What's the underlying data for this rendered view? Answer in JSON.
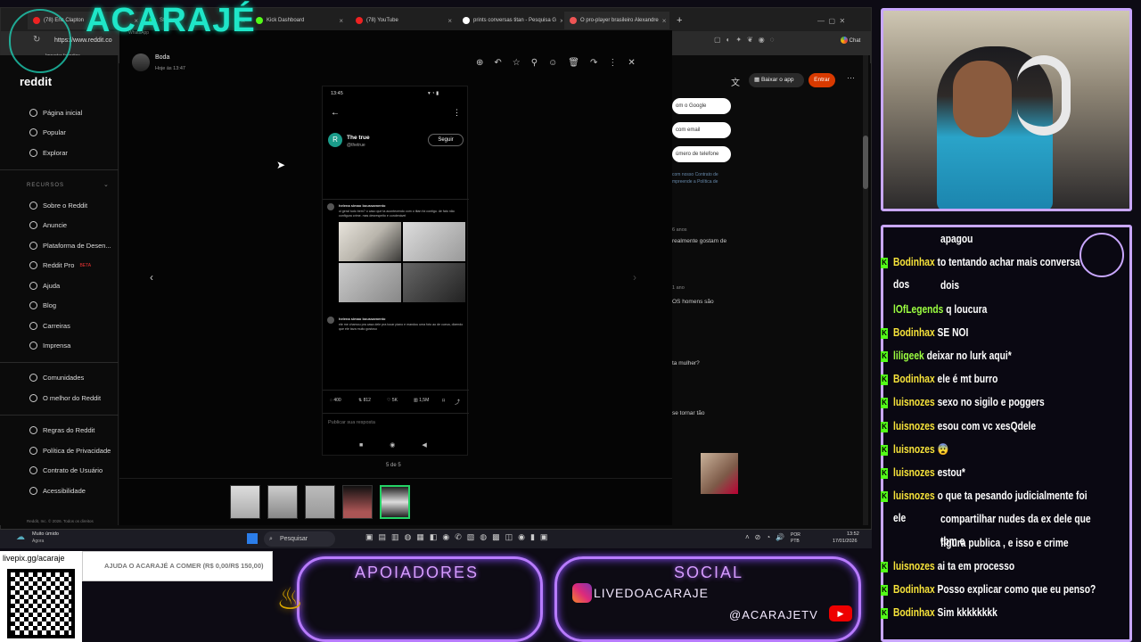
{
  "stream": {
    "logo_text": "ACARAJÉ",
    "qr_url": "livepix.gg/acaraje",
    "help_text": "AJUDA O ACARAJÉ A COMER (R$ 0,00/R$ 150,00)",
    "supporters_title": "APOIADORES",
    "social_title": "SOCIAL",
    "instagram_handle": "LIVEDOACARAJE",
    "youtube_handle": "@ACARAJETV"
  },
  "browser": {
    "tabs": [
      {
        "label": "(78) Eric Clapton"
      },
      {
        "label": "Stream"
      },
      {
        "label": "Kick Dashboard"
      },
      {
        "label": "(78) YouTube"
      },
      {
        "label": "prints conversas titan - Pesquisa G"
      },
      {
        "label": "O pro-player brasileiro Alexandre"
      }
    ],
    "url": "https://www.reddit.co",
    "bookmark_left": "Importar favoritos",
    "toolbar_download": "Baixar o app",
    "toolbar_login": "Entrar",
    "chat_label": "Chat"
  },
  "reddit_sidebar": {
    "logo": "reddit",
    "primary": [
      "Página inicial",
      "Popular",
      "Explorar"
    ],
    "section_label": "RECURSOS",
    "resources": [
      "Sobre o Reddit",
      "Anuncie",
      "Plataforma de Desen...",
      "Reddit Pro",
      "Ajuda",
      "Blog",
      "Carreiras",
      "Imprensa"
    ],
    "beta_badge": "BETA",
    "community": [
      "Comunidades",
      "O melhor do Reddit"
    ],
    "legal": [
      "Regras do Reddit",
      "Política de Privacidade",
      "Contrato de Usuário",
      "Acessibilidade"
    ],
    "footer": "Reddit, Inc. © 2026. Todos os direitos"
  },
  "viewer": {
    "sender": "Boda",
    "time": "Hoje às 13:47",
    "counter": "5 de 5",
    "app_label": "WhatsApp"
  },
  "phone": {
    "status_time": "13:45",
    "profile_name": "The true",
    "profile_handle": "@thetrue",
    "follow_label": "Seguir",
    "avatar_letter": "R",
    "tweet1_author": "helena simao boussamento",
    "tweet1_text": "oi geral tudo bem? o caso que ta acontecendo com o titan foi contigo. de fato não configura crime. mas desrespeito e condenável",
    "tweet2_author": "helena simao boussamento",
    "tweet2_text": "ele me chamou pra casa dele pra tocar piano e mandou uma foto ao de cueca, dizendo que ele tava muito gostoso",
    "stats": {
      "replies": "400",
      "retweets": "812",
      "likes": "5K",
      "views": "1,5M"
    },
    "reply_placeholder": "Publicar sua resposta"
  },
  "reddit_right": {
    "login_options": [
      "om o Google",
      "com email",
      "úmero de telefone"
    ],
    "terms": "com nosso Contrato de",
    "terms2": "mpreende a Política de",
    "snippets": [
      "6 anos",
      "realmente gostam de",
      "1 ano",
      "OS homens são",
      "ta mulher?",
      "se tornar tão"
    ]
  },
  "taskbar": {
    "weather": "Muito úmido",
    "weather_sub": "Agora",
    "search": "Pesquisar",
    "lang": "POR",
    "lang2": "PTB",
    "time": "13:52",
    "date": "17/01/2026"
  },
  "chat": {
    "messages": [
      {
        "user": "",
        "text": "apagou",
        "badge": false
      },
      {
        "user": "Bodinhax",
        "text": "to tentando achar mais conversa dos",
        "badge": true
      },
      {
        "user": "",
        "text": "dois",
        "badge": false
      },
      {
        "user": "lOfLegends",
        "text": "q loucura",
        "badge": false,
        "green": true
      },
      {
        "user": "Bodinhax",
        "text": "SE NOI",
        "badge": true
      },
      {
        "user": "liligeek",
        "text": "deixar no lurk aqui*",
        "badge": true,
        "green": true
      },
      {
        "user": "Bodinhax",
        "text": "ele é mt burro",
        "badge": true
      },
      {
        "user": "luisnozes",
        "text": "sexo no sigilo e poggers",
        "badge": true
      },
      {
        "user": "luisnozes",
        "text": "esou com vc xesQdele",
        "badge": true
      },
      {
        "user": "luisnozes",
        "text": "😨",
        "badge": true
      },
      {
        "user": "luisnozes",
        "text": "estou*",
        "badge": true
      },
      {
        "user": "luisnozes",
        "text": "o que ta pesando judicialmente foi ele",
        "badge": true
      },
      {
        "user": "",
        "text": "compartilhar nudes da ex dele que tbm e",
        "badge": false
      },
      {
        "user": "",
        "text": "figura publica , e isso e crime",
        "badge": false
      },
      {
        "user": "luisnozes",
        "text": "ai ta em processo",
        "badge": true
      },
      {
        "user": "Bodinhax",
        "text": "Posso explicar como que eu penso?",
        "badge": true
      },
      {
        "user": "Bodinhax",
        "text": "Sim kkkkkkkk",
        "badge": true
      }
    ]
  },
  "colors": {
    "neon": "#b87bff",
    "chat_user": "#f7e33a",
    "kick_green": "#53fc18",
    "reddit_orange": "#d93a00"
  }
}
